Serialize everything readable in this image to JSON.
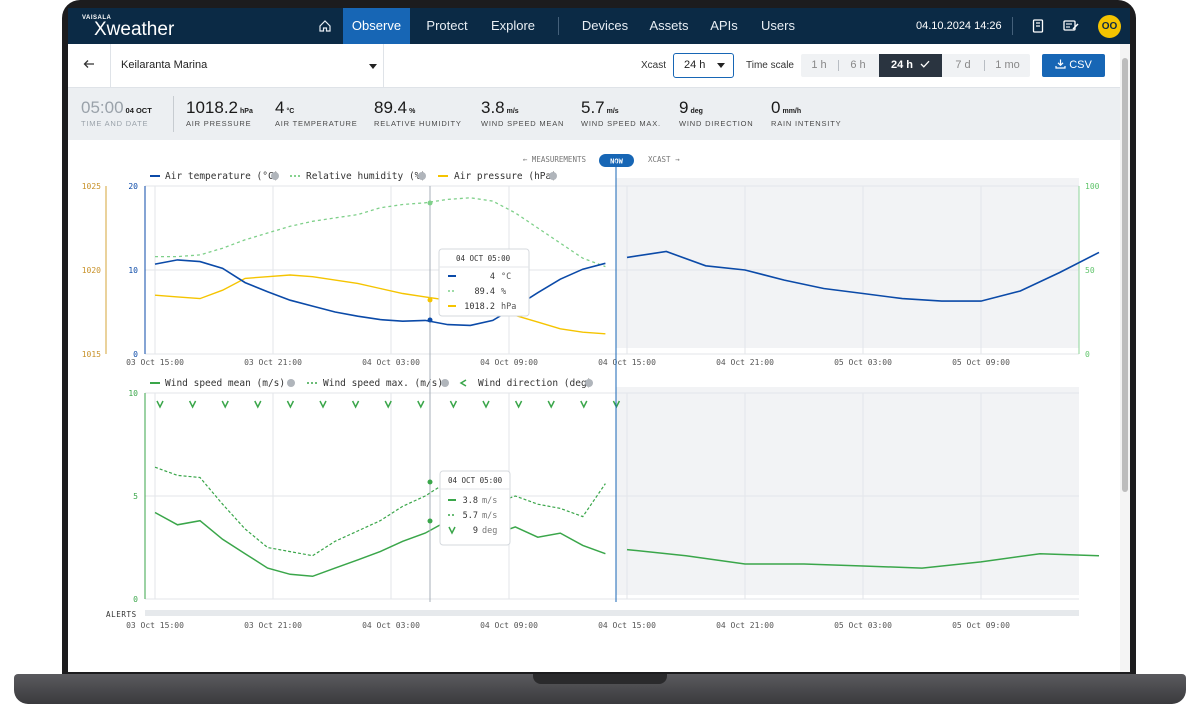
{
  "nav": {
    "brand_small": "VAISALA",
    "brand_main": "Xweather",
    "items": [
      {
        "label": "Observe",
        "active": true
      },
      {
        "label": "Protect"
      },
      {
        "label": "Explore"
      },
      {
        "label": "Devices"
      },
      {
        "label": "Assets"
      },
      {
        "label": "APIs"
      },
      {
        "label": "Users"
      }
    ],
    "datetime": "04.10.2024 14:26",
    "avatar_initials": "OO"
  },
  "toolbar": {
    "back_icon": "arrow-left-icon",
    "station": "Keilaranta Marina",
    "xcast_label": "Xcast",
    "xcast_value": "24 h",
    "timescale_label": "Time scale",
    "timescale_options": [
      "1 h",
      "6 h",
      "24 h",
      "7 d",
      "1 mo"
    ],
    "timescale_selected": "24 h",
    "csv_label": "CSV"
  },
  "metrics": {
    "time": {
      "value": "05:00",
      "date": "04 OCT",
      "label": "TIME AND DATE"
    },
    "pressure": {
      "value": "1018.2",
      "unit": "hPa",
      "label": "AIR PRESSURE"
    },
    "temperature": {
      "value": "4",
      "unit": "°C",
      "label": "AIR TEMPERATURE"
    },
    "humidity": {
      "value": "89.4",
      "unit": "%",
      "label": "RELATIVE HUMIDITY"
    },
    "wind_mean": {
      "value": "3.8",
      "unit": "m/s",
      "label": "WIND SPEED MEAN"
    },
    "wind_max": {
      "value": "5.7",
      "unit": "m/s",
      "label": "WIND SPEED MAX."
    },
    "wind_dir": {
      "value": "9",
      "unit": "deg",
      "label": "WIND DIRECTION"
    },
    "rain": {
      "value": "0",
      "unit": "mm/h",
      "label": "RAIN INTENSITY"
    }
  },
  "timeline": {
    "measurements_label": "← MEASUREMENTS",
    "now_label": "NOW",
    "xcast_label": "XCAST →"
  },
  "colors": {
    "nav_bg": "#0b2a45",
    "accent": "#1766b5",
    "temperature": "#0b4aa8",
    "humidity": "#5fc46a",
    "pressure": "#f5c400",
    "wind": "#3aa64a",
    "forecast_bg": "#f2f3f5"
  },
  "chart_data": [
    {
      "type": "line",
      "legend": [
        "Air temperature (°C)",
        "Relative humidity (%)",
        "Air pressure (hPa)"
      ],
      "x_ticks": [
        "03 Oct 15:00",
        "03 Oct 21:00",
        "04 Oct 03:00",
        "04 Oct 09:00",
        "04 Oct 15:00",
        "04 Oct 21:00",
        "05 Oct 03:00",
        "05 Oct 09:00"
      ],
      "y_left_ticks": [
        "20",
        "10",
        "0"
      ],
      "y_pressure_ticks": [
        "1025",
        "1020",
        "1015"
      ],
      "y_right_ticks": [
        "100",
        "50",
        "0"
      ],
      "ylim_left": [
        0,
        20
      ],
      "ylim_pressure": [
        1015,
        1025
      ],
      "ylim_right": [
        0,
        100
      ],
      "hours": [
        0,
        1,
        2,
        3,
        4,
        5,
        6,
        7,
        8,
        9,
        10,
        11,
        12,
        13,
        14,
        15,
        16,
        17,
        18,
        19,
        20,
        21,
        22,
        23,
        24
      ],
      "series": [
        {
          "name": "Air temperature (°C)",
          "values": [
            10.7,
            11.2,
            11.0,
            10.2,
            8.5,
            7.4,
            6.4,
            5.7,
            5.0,
            4.5,
            4.1,
            3.9,
            4.0,
            3.5,
            3.4,
            4.0,
            5.6,
            7.3,
            8.9,
            10.1,
            10.8
          ]
        },
        {
          "name": "Relative humidity (%)",
          "values": [
            58,
            58,
            59,
            63,
            68,
            72,
            76,
            79,
            81,
            83,
            87,
            89,
            90,
            92,
            93,
            91,
            84,
            75,
            66,
            57,
            52
          ]
        },
        {
          "name": "Air pressure (hPa)",
          "values": [
            1018.5,
            1018.4,
            1018.3,
            1018.8,
            1019.5,
            1019.6,
            1019.7,
            1019.6,
            1019.4,
            1019.2,
            1018.9,
            1018.6,
            1018.4,
            1018.2,
            1017.9,
            1017.7,
            1017.3,
            1016.9,
            1016.5,
            1016.3,
            1016.2
          ]
        }
      ],
      "forecast": {
        "name": "Air temperature (°C)",
        "hours": [
          24,
          26,
          28,
          30,
          32,
          34,
          36,
          38,
          40,
          42,
          44,
          46,
          48
        ],
        "values": [
          11.5,
          12.2,
          10.5,
          10.0,
          8.8,
          7.8,
          7.2,
          6.6,
          6.3,
          6.3,
          7.5,
          9.7,
          12.1
        ]
      },
      "tooltip": {
        "title": "04 OCT 05:00",
        "rows": [
          {
            "value": "4",
            "unit": "°C"
          },
          {
            "value": "89.4",
            "unit": "%"
          },
          {
            "value": "1018.2",
            "unit": "hPa"
          }
        ]
      }
    },
    {
      "type": "line",
      "legend": [
        "Wind speed mean (m/s)",
        "Wind speed max. (m/s)",
        "Wind direction (deg)"
      ],
      "y_ticks": [
        "10",
        "5",
        "0"
      ],
      "ylim": [
        0,
        10
      ],
      "series": [
        {
          "name": "Wind speed mean (m/s)",
          "values": [
            4.2,
            3.6,
            3.8,
            2.9,
            2.2,
            1.5,
            1.2,
            1.1,
            1.5,
            1.9,
            2.3,
            2.8,
            3.2,
            3.8,
            3.0,
            3.1,
            3.5,
            3.0,
            3.2,
            2.6,
            2.2
          ]
        },
        {
          "name": "Wind speed max. (m/s)",
          "values": [
            6.4,
            6.0,
            5.9,
            4.6,
            3.4,
            2.5,
            2.3,
            2.1,
            2.8,
            3.3,
            3.8,
            4.5,
            5.0,
            5.7,
            4.4,
            4.6,
            5.0,
            4.6,
            4.4,
            4.0,
            5.6
          ]
        }
      ],
      "forecast": {
        "name": "Wind speed mean (m/s)",
        "hours": [
          24,
          27,
          30,
          33,
          36,
          39,
          42,
          45,
          48
        ],
        "values": [
          2.4,
          2.1,
          1.7,
          1.7,
          1.6,
          1.5,
          1.8,
          2.2,
          2.1
        ]
      },
      "direction_count": 15,
      "tooltip": {
        "title": "04 OCT 05:00",
        "rows": [
          {
            "value": "3.8",
            "unit": "m/s"
          },
          {
            "value": "5.7",
            "unit": "m/s"
          },
          {
            "value": "9",
            "unit": "deg"
          }
        ]
      }
    }
  ],
  "alerts_label": "ALERTS"
}
